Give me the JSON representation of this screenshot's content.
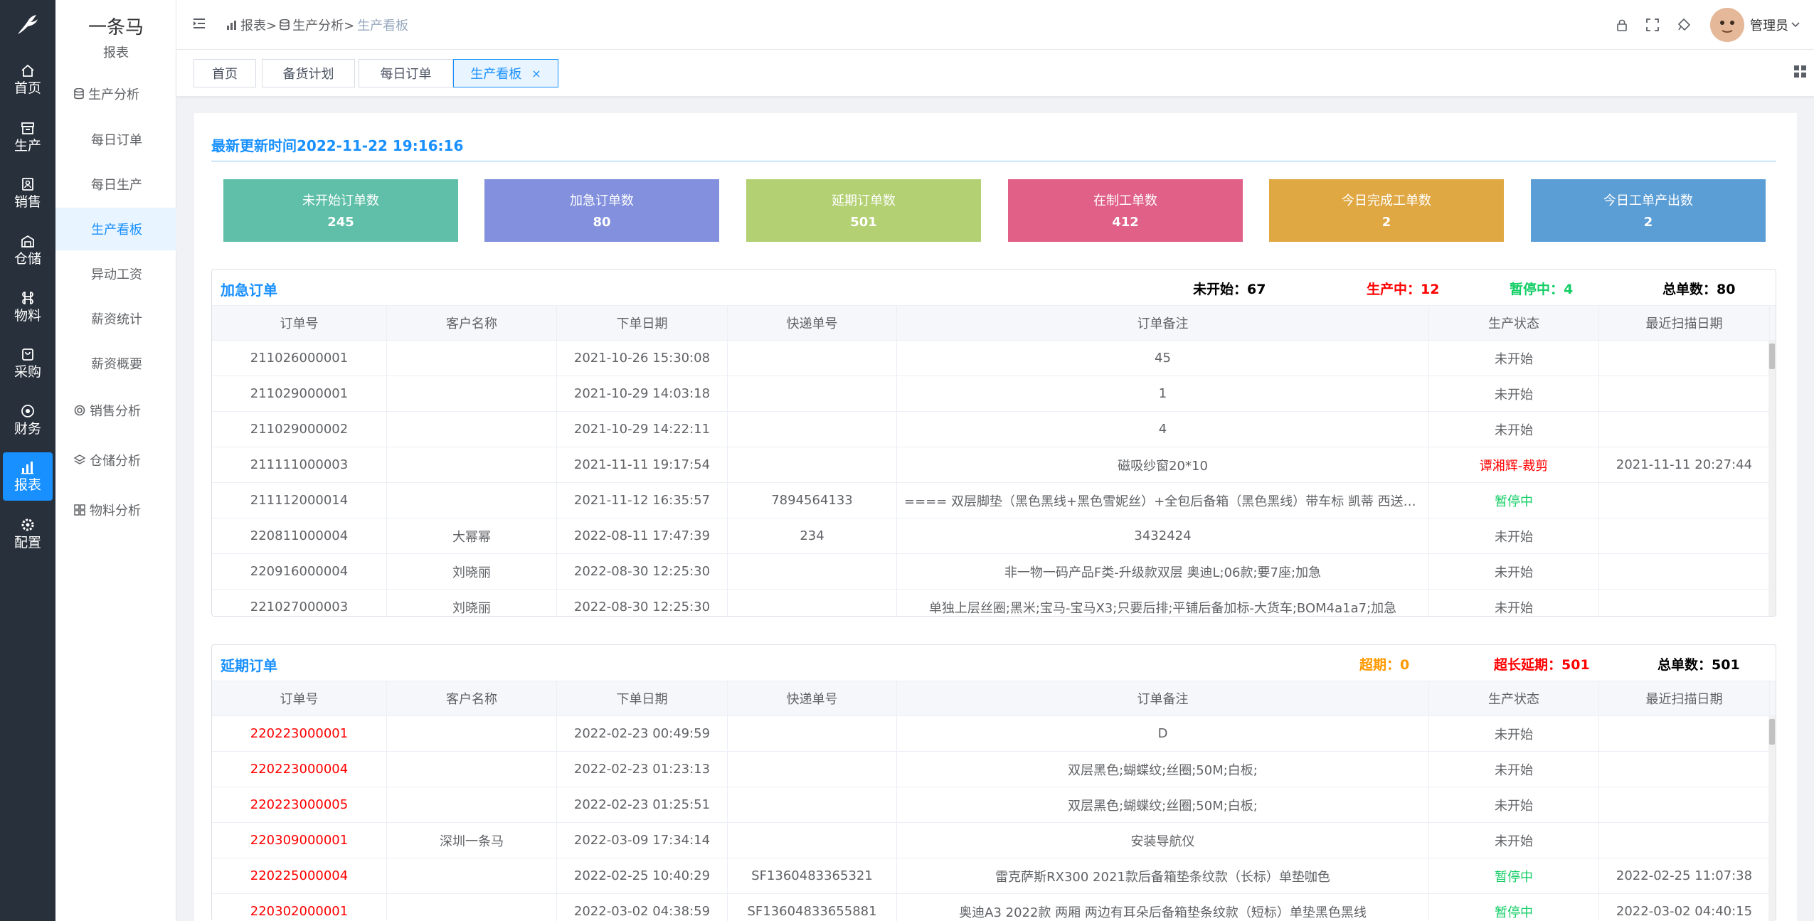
{
  "rail": {
    "items": [
      {
        "label": "首页",
        "icon": "home-icon"
      },
      {
        "label": "生产",
        "icon": "production-icon"
      },
      {
        "label": "销售",
        "icon": "sales-icon"
      },
      {
        "label": "仓储",
        "icon": "warehouse-icon"
      },
      {
        "label": "物料",
        "icon": "material-icon"
      },
      {
        "label": "采购",
        "icon": "purchase-icon"
      },
      {
        "label": "财务",
        "icon": "finance-icon"
      },
      {
        "label": "报表",
        "icon": "report-icon"
      },
      {
        "label": "配置",
        "icon": "config-icon"
      }
    ]
  },
  "sidebar": {
    "brand": "一条马",
    "section": "报表",
    "items": [
      {
        "label": "生产分析",
        "type": "group"
      },
      {
        "label": "每日订单",
        "type": "child"
      },
      {
        "label": "每日生产",
        "type": "child"
      },
      {
        "label": "生产看板",
        "type": "child"
      },
      {
        "label": "异动工资",
        "type": "child"
      },
      {
        "label": "薪资统计",
        "type": "child"
      },
      {
        "label": "薪资概要",
        "type": "child"
      },
      {
        "label": "销售分析",
        "type": "group"
      },
      {
        "label": "仓储分析",
        "type": "group"
      },
      {
        "label": "物料分析",
        "type": "group"
      }
    ]
  },
  "header": {
    "breadcrumb": [
      "报表>",
      "生产分析>",
      "生产看板"
    ],
    "user": "管理员"
  },
  "tabs": [
    {
      "label": "首页"
    },
    {
      "label": "备货计划"
    },
    {
      "label": "每日订单"
    },
    {
      "label": "生产看板",
      "close": "×"
    }
  ],
  "update_time": "最新更新时间2022-11-22 19:16:16",
  "stats": [
    {
      "title": "未开始订单数",
      "value": "245",
      "color": "#5fbfa8"
    },
    {
      "title": "加急订单数",
      "value": "80",
      "color": "#8290dd"
    },
    {
      "title": "延期订单数",
      "value": "501",
      "color": "#b3d073"
    },
    {
      "title": "在制工单数",
      "value": "412",
      "color": "#e06088"
    },
    {
      "title": "今日完成工单数",
      "value": "2",
      "color": "#e0a843"
    },
    {
      "title": "今日工单产出数",
      "value": "2",
      "color": "#5b9ed6"
    }
  ],
  "columns": [
    "订单号",
    "客户名称",
    "下单日期",
    "快递单号",
    "订单备注",
    "生产状态",
    "最近扫描日期"
  ],
  "urgent": {
    "title": "加急订单",
    "summary": [
      {
        "label": "未开始：",
        "value": "67",
        "color": "#000000"
      },
      {
        "label": "生产中：",
        "value": "12",
        "color": "#ff0000"
      },
      {
        "label": "暂停中：",
        "value": "4",
        "color": "#13ce66"
      },
      {
        "label": "总单数：",
        "value": "80",
        "color": "#000000"
      }
    ],
    "rows": [
      [
        "211026000001",
        "",
        "2021-10-26 15:30:08",
        "",
        "45",
        "未开始",
        ""
      ],
      [
        "211029000001",
        "",
        "2021-10-29 14:03:18",
        "",
        "1",
        "未开始",
        ""
      ],
      [
        "211029000002",
        "",
        "2021-10-29 14:22:11",
        "",
        "4",
        "未开始",
        ""
      ],
      [
        "211111000003",
        "",
        "2021-11-11 19:17:54",
        "",
        "磁吸纱窗20*10",
        "谭湘辉-裁剪",
        "2021-11-11 20:27:44"
      ],
      [
        "211112000014",
        "",
        "2021-11-12 16:35:57",
        "7894564133",
        "==== 双层脚垫（黑色黑线+黑色雪妮丝）+全包后备箱（黑色黑线）带车标 凯蒂 西送防蹋...",
        "暂停中",
        ""
      ],
      [
        "220811000004",
        "大幂幂",
        "2022-08-11 17:47:39",
        "234",
        "3432424",
        "未开始",
        ""
      ],
      [
        "220916000004",
        "刘晓丽",
        "2022-08-30 12:25:30",
        "",
        "非一物一码产品F类-升级款双层 奥迪L;06款;要7座;加急",
        "未开始",
        ""
      ],
      [
        "221027000003",
        "刘晓丽",
        "2022-08-30 12:25:30",
        "",
        "单独上层丝圈;黑米;宝马-宝马X3;只要后排;平铺后备加标-大货车;BOM4a1a7;加急",
        "未开始",
        ""
      ]
    ]
  },
  "delayed": {
    "title": "延期订单",
    "summary": [
      {
        "label": "超期：",
        "value": "0",
        "color": "#ff9900"
      },
      {
        "label": "超长延期：",
        "value": "501",
        "color": "#ff0000"
      },
      {
        "label": "总单数：",
        "value": "501",
        "color": "#000000"
      }
    ],
    "rows": [
      [
        "220223000001",
        "",
        "2022-02-23 00:49:59",
        "",
        "D",
        "未开始",
        ""
      ],
      [
        "220223000004",
        "",
        "2022-02-23 01:23:13",
        "",
        "双层黑色;蝴蝶纹;丝圈;50M;白板;",
        "未开始",
        ""
      ],
      [
        "220223000005",
        "",
        "2022-02-23 01:25:51",
        "",
        "双层黑色;蝴蝶纹;丝圈;50M;白板;",
        "未开始",
        ""
      ],
      [
        "220309000001",
        "深圳一条马",
        "2022-03-09 17:34:14",
        "",
        "安装导航仪",
        "未开始",
        ""
      ],
      [
        "220225000004",
        "",
        "2022-02-25 10:40:29",
        "SF1360483365321",
        "雷克萨斯RX300 2021款后备箱垫条纹款（长标）单垫咖色",
        "暂停中",
        "2022-02-25 11:07:38"
      ],
      [
        "220302000001",
        "",
        "2022-03-02 04:38:59",
        "SF13604833655881",
        "奥迪A3 2022款 两厢 两边有耳朵后备箱垫条纹款（短标）单垫黑色黑线",
        "暂停中",
        "2022-03-02 04:40:15"
      ]
    ]
  }
}
